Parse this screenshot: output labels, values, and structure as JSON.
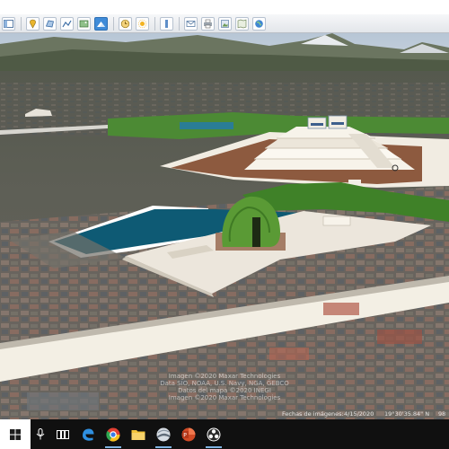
{
  "toolbar": {
    "buttons": [
      {
        "name": "hide-sidebar-button",
        "icon": "sidebar-icon"
      },
      {
        "name": "add-placemark-button",
        "icon": "placemark-icon"
      },
      {
        "name": "add-polygon-button",
        "icon": "polygon-icon"
      },
      {
        "name": "add-path-button",
        "icon": "path-icon"
      },
      {
        "name": "add-overlay-button",
        "icon": "overlay-icon"
      },
      {
        "name": "record-tour-button",
        "icon": "tour-icon"
      },
      {
        "name": "historical-imagery-button",
        "icon": "clock-icon"
      },
      {
        "name": "sunlight-button",
        "icon": "sun-icon"
      },
      {
        "name": "switch-planet-button",
        "icon": "planet-icon"
      },
      {
        "name": "ruler-button",
        "icon": "ruler-icon"
      },
      {
        "name": "email-button",
        "icon": "email-icon"
      },
      {
        "name": "print-button",
        "icon": "print-icon"
      },
      {
        "name": "save-image-button",
        "icon": "save-image-icon"
      },
      {
        "name": "view-in-maps-button",
        "icon": "map-icon"
      },
      {
        "name": "globe-button",
        "icon": "globe-icon"
      }
    ]
  },
  "map": {
    "attribution": [
      "Imagen ©2020 Maxar Technologies",
      "Data SIO, NOAA, U.S. Navy, NGA, GEBCO",
      "Datos del mapa ©2020 INEGI",
      "Imagen ©2020 Maxar Technologies"
    ],
    "imagery_date_label": "Fechas de imágenes:",
    "imagery_date": "4/15/2020",
    "coordinates": "19°30'35.84\" N",
    "elevation": "98"
  },
  "taskbar": {
    "items": [
      {
        "name": "task-view-button",
        "icon": "task-view-icon"
      },
      {
        "name": "edge-button",
        "icon": "edge-icon"
      },
      {
        "name": "chrome-button",
        "icon": "chrome-icon"
      },
      {
        "name": "file-explorer-button",
        "icon": "folder-icon"
      },
      {
        "name": "google-earth-button",
        "icon": "google-earth-icon"
      },
      {
        "name": "powerpoint-button",
        "icon": "powerpoint-icon"
      },
      {
        "name": "obs-button",
        "icon": "obs-icon"
      }
    ]
  },
  "colors": {
    "toolbar_active": "#3f8bd8",
    "water": "#0e5a74",
    "plaza": "#ece6dc",
    "taskbar": "#101010"
  }
}
